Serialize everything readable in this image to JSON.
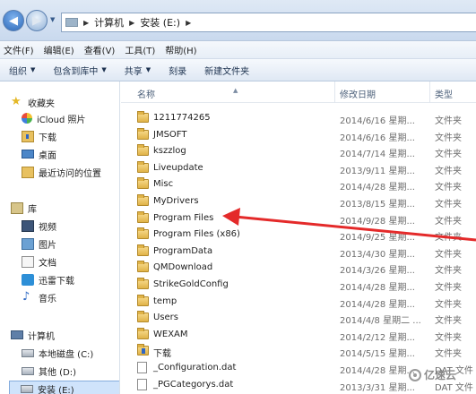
{
  "address": {
    "segments": [
      "计算机",
      "安装 (E:)"
    ]
  },
  "menu": [
    "文件(F)",
    "编辑(E)",
    "查看(V)",
    "工具(T)",
    "帮助(H)"
  ],
  "toolbar": {
    "organize": "组织",
    "include_in_library": "包含到库中",
    "share": "共享",
    "burn": "刻录",
    "new_folder": "新建文件夹"
  },
  "sidebar": {
    "favorites": {
      "label": "收藏夹",
      "items": [
        "iCloud 照片",
        "下载",
        "桌面",
        "最近访问的位置"
      ]
    },
    "libraries": {
      "label": "库",
      "items": [
        "视频",
        "图片",
        "文档",
        "迅雷下载",
        "音乐"
      ]
    },
    "computer": {
      "label": "计算机",
      "items": [
        "本地磁盘 (C:)",
        "其他 (D:)",
        "安装 (E:)"
      ]
    }
  },
  "columns": {
    "name": "名称",
    "modified": "修改日期",
    "type": "类型"
  },
  "files": [
    {
      "name": "1211774265",
      "date": "2014/6/16 星期...",
      "type": "文件夹",
      "kind": "folder"
    },
    {
      "name": "JMSOFT",
      "date": "2014/6/16 星期...",
      "type": "文件夹",
      "kind": "folder"
    },
    {
      "name": "kszzlog",
      "date": "2014/7/14 星期...",
      "type": "文件夹",
      "kind": "folder"
    },
    {
      "name": "Liveupdate",
      "date": "2013/9/11 星期...",
      "type": "文件夹",
      "kind": "folder"
    },
    {
      "name": "Misc",
      "date": "2014/4/28 星期...",
      "type": "文件夹",
      "kind": "folder"
    },
    {
      "name": "MyDrivers",
      "date": "2013/8/15 星期...",
      "type": "文件夹",
      "kind": "folder"
    },
    {
      "name": "Program Files",
      "date": "2014/9/28 星期...",
      "type": "文件夹",
      "kind": "folder"
    },
    {
      "name": "Program Files (x86)",
      "date": "2014/9/25 星期...",
      "type": "文件夹",
      "kind": "folder"
    },
    {
      "name": "ProgramData",
      "date": "2013/4/30 星期...",
      "type": "文件夹",
      "kind": "folder"
    },
    {
      "name": "QMDownload",
      "date": "2014/3/26 星期...",
      "type": "文件夹",
      "kind": "folder"
    },
    {
      "name": "StrikeGoldConfig",
      "date": "2014/4/28 星期...",
      "type": "文件夹",
      "kind": "folder"
    },
    {
      "name": "temp",
      "date": "2014/4/28 星期...",
      "type": "文件夹",
      "kind": "folder"
    },
    {
      "name": "Users",
      "date": "2014/4/8 星期二 ...",
      "type": "文件夹",
      "kind": "folder"
    },
    {
      "name": "WEXAM",
      "date": "2014/2/12 星期...",
      "type": "文件夹",
      "kind": "folder"
    },
    {
      "name": "下载",
      "date": "2014/5/15 星期...",
      "type": "文件夹",
      "kind": "dlfolder"
    },
    {
      "name": "_Configuration.dat",
      "date": "2014/4/28 星期...",
      "type": "DAT 文件",
      "kind": "file"
    },
    {
      "name": "_PGCategorys.dat",
      "date": "2013/3/31 星期...",
      "type": "DAT 文件",
      "kind": "file"
    }
  ],
  "watermark": "亿速云"
}
